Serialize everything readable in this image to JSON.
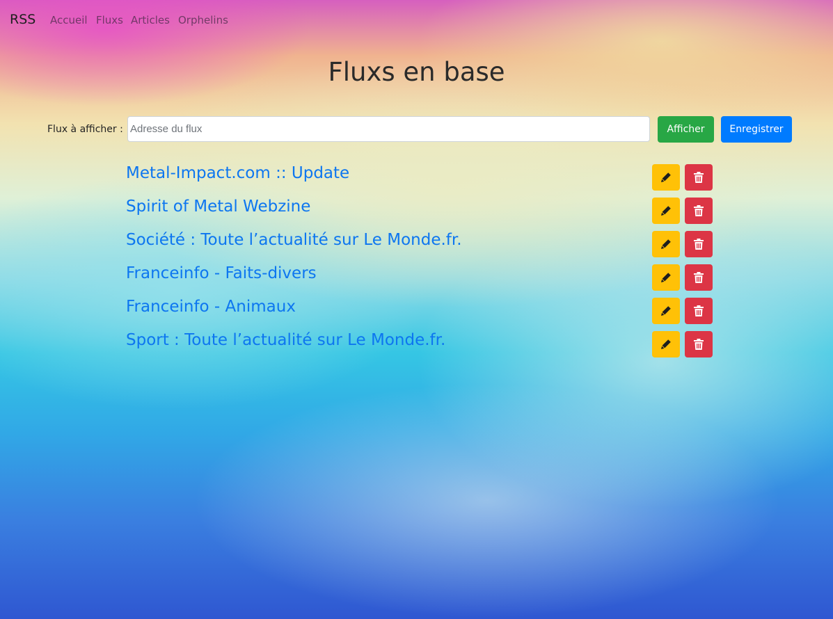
{
  "navbar": {
    "brand": "RSS",
    "links": [
      {
        "label": "Accueil"
      },
      {
        "label": "Fluxs"
      },
      {
        "label": "Articles"
      },
      {
        "label": "Orphelins"
      }
    ]
  },
  "page": {
    "title": "Fluxs en base"
  },
  "form": {
    "label": "Flux à afficher :",
    "input_value": "",
    "input_placeholder": "Adresse du flux",
    "show_button": "Afficher",
    "save_button": "Enregistrer"
  },
  "feeds": [
    {
      "title": "Metal-Impact.com :: Update"
    },
    {
      "title": "Spirit of Metal Webzine"
    },
    {
      "title": "Société : Toute l’actualité sur Le Monde.fr."
    },
    {
      "title": "Franceinfo - Faits-divers"
    },
    {
      "title": "Franceinfo - Animaux"
    },
    {
      "title": "Sport : Toute l’actualité sur Le Monde.fr."
    }
  ],
  "icons": {
    "edit": "pencil-icon",
    "delete": "trash-icon"
  },
  "colors": {
    "link": "#0d76f0",
    "success": "#28a745",
    "primary": "#007bff",
    "warning": "#ffc107",
    "danger": "#dc3545"
  }
}
